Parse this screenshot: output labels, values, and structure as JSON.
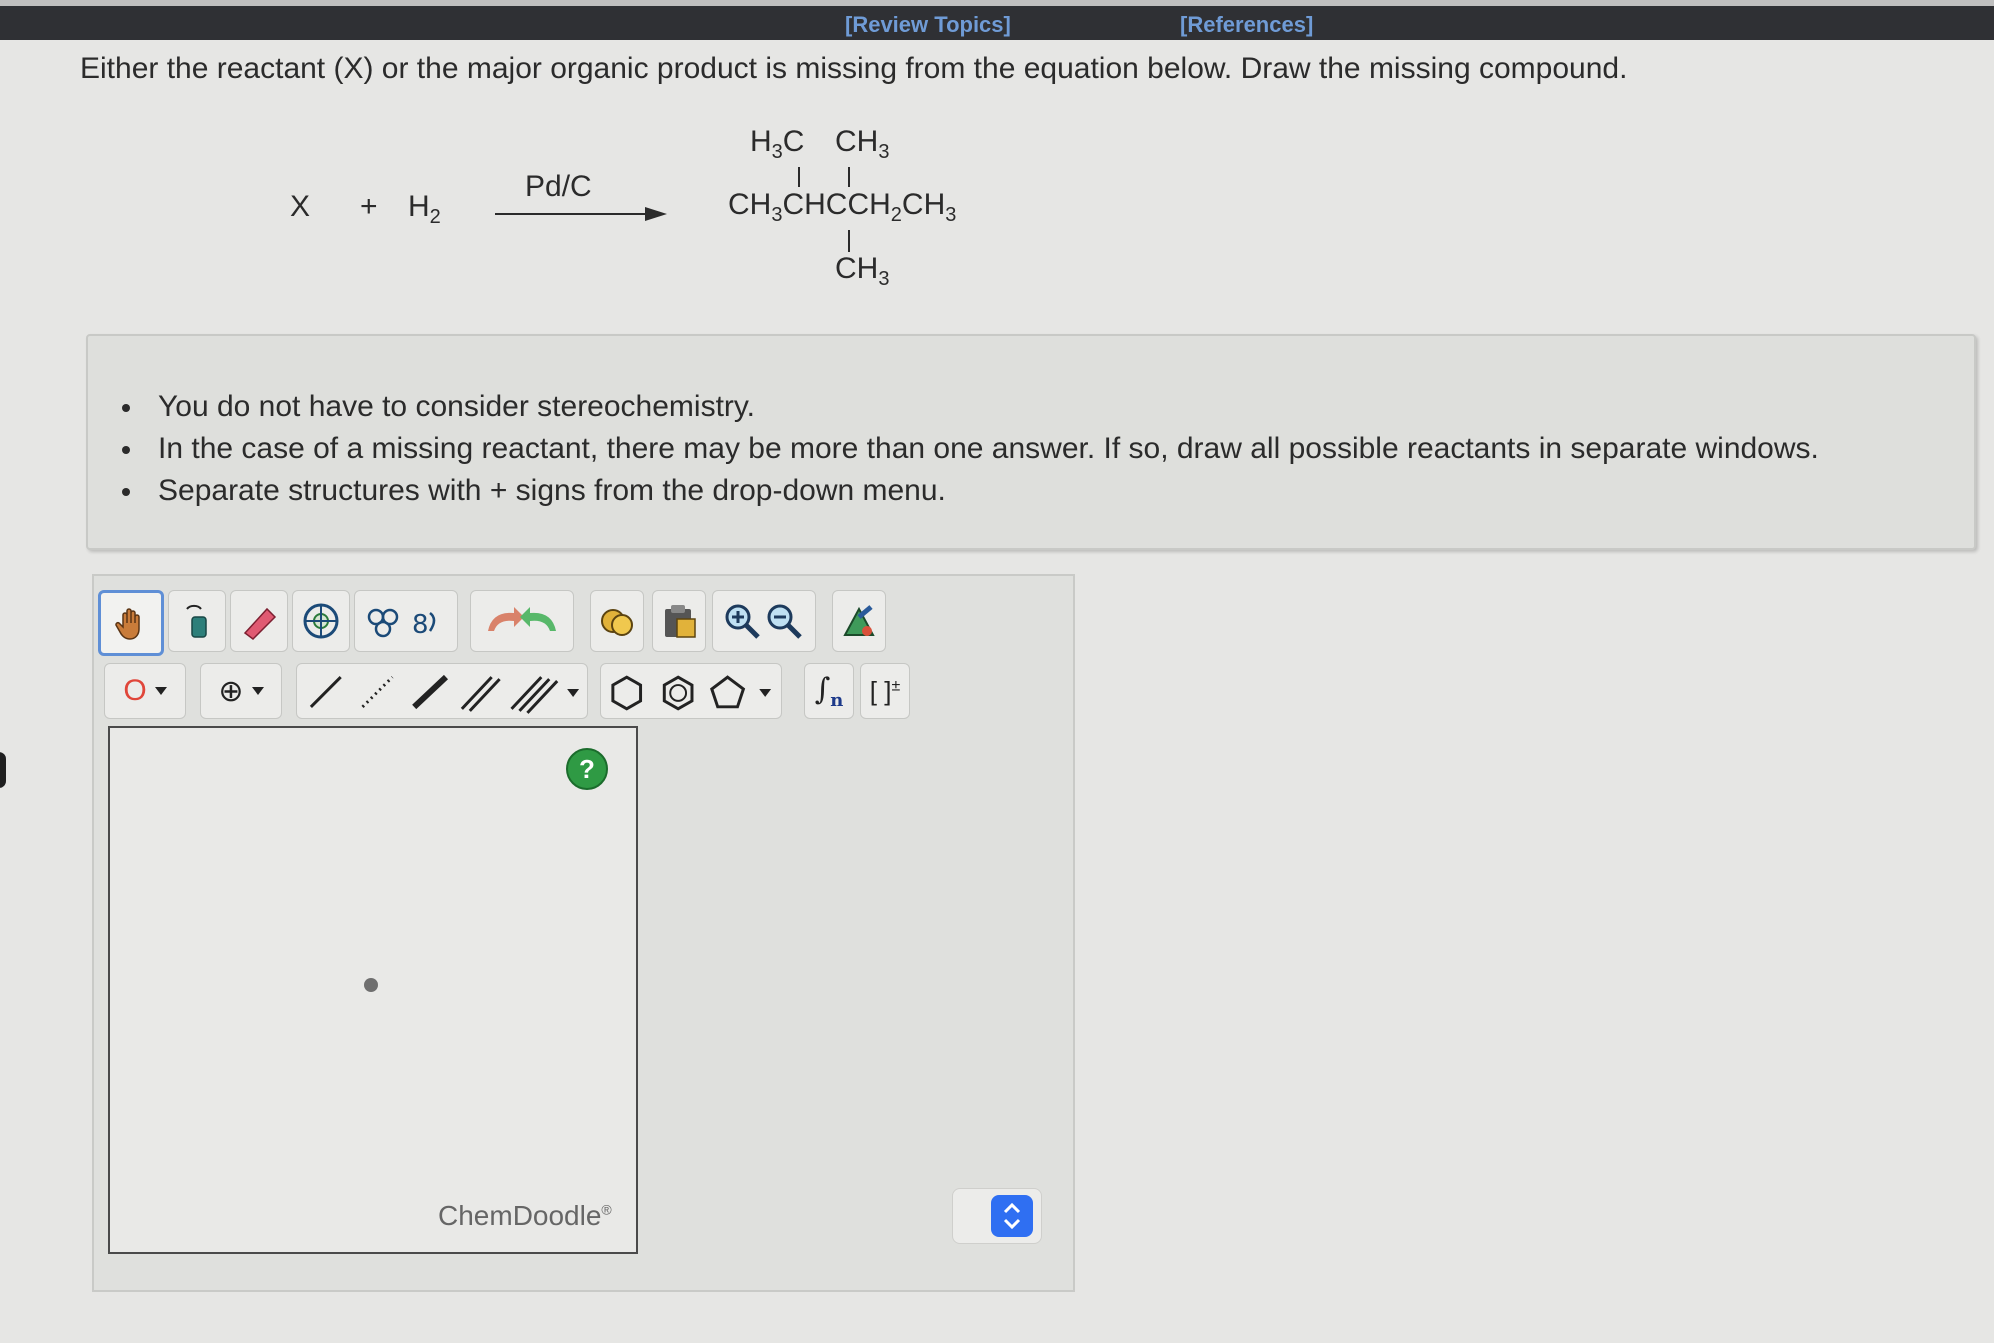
{
  "topbar": {
    "review_topics": "[Review Topics]",
    "references": "[References]"
  },
  "question": "Either the reactant (X) or the major organic product is missing from the equation below. Draw the missing compound.",
  "equation": {
    "reactant": "X",
    "plus": "+",
    "h2_base": "H",
    "h2_sub": "2",
    "catalyst": "Pd/C"
  },
  "product": {
    "h3c_left": [
      "H",
      "3",
      "C"
    ],
    "ch3_top": [
      "CH",
      "3"
    ],
    "main_chain": [
      "CH",
      "3",
      "CHCCH",
      "2",
      "CH",
      "3"
    ],
    "ch3_bottom": [
      "CH",
      "3"
    ]
  },
  "notes": [
    "You do not have to consider stereochemistry.",
    "In the case of a missing reactant, there may be more than one answer. If so, draw all possible reactants in separate windows.",
    "Separate structures with + signs from the drop-down menu."
  ],
  "editor": {
    "atom_label": "O",
    "charge_symbol": "⊕",
    "bracket_label": "[ ]",
    "bracket_sup": "±",
    "repeat_sub": "n",
    "help_label": "?",
    "brand": "ChemDoodle",
    "brand_mark": "®"
  },
  "colors": {
    "topbar": "#2f3034",
    "link": "#6f9bd6",
    "help_green": "#2f9a44",
    "spinner_blue": "#2f6ff2",
    "selected_border": "#5f8fd6"
  }
}
